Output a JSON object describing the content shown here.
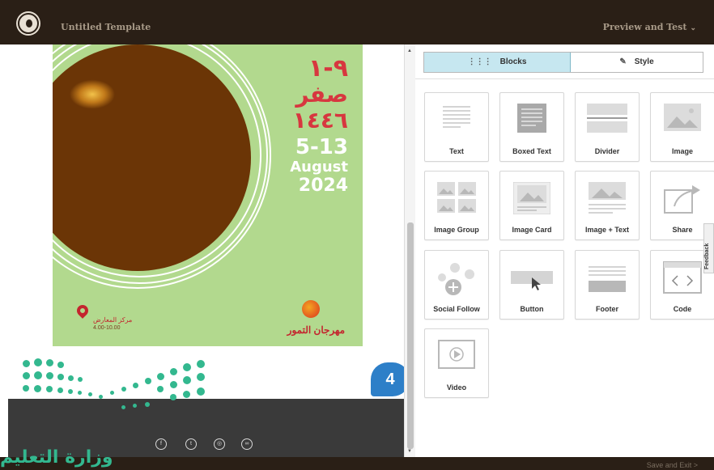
{
  "topbar": {
    "title": "Untitled Template",
    "preview": "Preview and Test",
    "preview_chevron": "⌄"
  },
  "poster": {
    "hijri_days": "٩-١",
    "hijri_month": "صفر",
    "hijri_year": "١٤٤٦",
    "greg_days": "5-13",
    "greg_month": "August",
    "greg_year": "2024",
    "location_name": "مركز المعارض",
    "location_hours": "4.00-10.00",
    "festival_name": "مهرجان التمور",
    "colors": {
      "background": "#b2d98e",
      "hijri": "#d7373f",
      "accent_red": "#c4252e"
    }
  },
  "social_icons": [
    "facebook-icon",
    "twitter-icon",
    "instagram-icon",
    "link-icon"
  ],
  "social_glyphs": [
    "f",
    "t",
    "◎",
    "∞"
  ],
  "badge": "4",
  "panel": {
    "tabs": [
      {
        "label": "Blocks",
        "icon": "grid-icon",
        "active": true
      },
      {
        "label": "Style",
        "icon": "brush-icon",
        "active": false
      }
    ],
    "blocks": [
      {
        "label": "Text"
      },
      {
        "label": "Boxed Text"
      },
      {
        "label": "Divider"
      },
      {
        "label": "Image"
      },
      {
        "label": "Image Group"
      },
      {
        "label": "Image Card"
      },
      {
        "label": "Image + Text"
      },
      {
        "label": "Share"
      },
      {
        "label": "Social Follow"
      },
      {
        "label": "Button"
      },
      {
        "label": "Footer"
      },
      {
        "label": "Code"
      },
      {
        "label": "Video"
      }
    ]
  },
  "feedback": "Feedback",
  "bottombar": {
    "save_exit": "Save and Exit >"
  },
  "watermark": "وزارة التعليم"
}
